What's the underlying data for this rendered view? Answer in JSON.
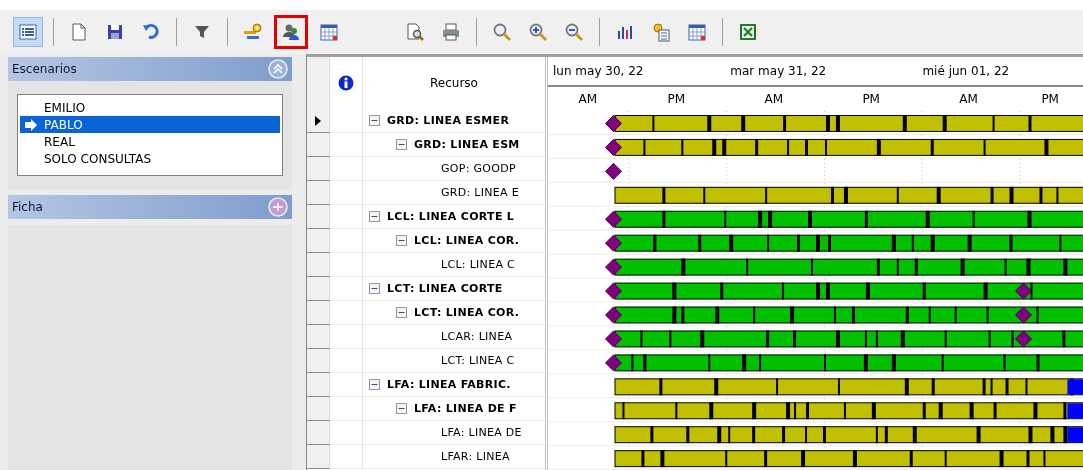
{
  "toolbar": {
    "items": [
      {
        "kind": "list",
        "selected": true,
        "outlined": false
      },
      {
        "kind": "separator"
      },
      {
        "kind": "new",
        "selected": false,
        "outlined": false
      },
      {
        "kind": "save",
        "selected": false,
        "outlined": false
      },
      {
        "kind": "undo",
        "selected": false,
        "outlined": false
      },
      {
        "kind": "separator"
      },
      {
        "kind": "filter",
        "selected": false,
        "outlined": false
      },
      {
        "kind": "separator"
      },
      {
        "kind": "resources",
        "selected": false,
        "outlined": false
      },
      {
        "kind": "users",
        "selected": false,
        "outlined": true
      },
      {
        "kind": "calendar",
        "selected": false,
        "outlined": false
      },
      {
        "kind": "spacer"
      },
      {
        "kind": "preview",
        "selected": false,
        "outlined": false
      },
      {
        "kind": "print",
        "selected": false,
        "outlined": false
      },
      {
        "kind": "separator"
      },
      {
        "kind": "search",
        "selected": false,
        "outlined": false
      },
      {
        "kind": "zoom-in",
        "selected": false,
        "outlined": false
      },
      {
        "kind": "zoom-out",
        "selected": false,
        "outlined": false
      },
      {
        "kind": "separator"
      },
      {
        "kind": "chart",
        "selected": false,
        "outlined": false
      },
      {
        "kind": "tasks",
        "selected": false,
        "outlined": false
      },
      {
        "kind": "calendar",
        "selected": false,
        "outlined": false
      },
      {
        "kind": "separator"
      },
      {
        "kind": "excel",
        "selected": false,
        "outlined": false
      }
    ]
  },
  "sidebar": {
    "panels": [
      {
        "title": "Escenarios",
        "expanded": true,
        "items": [
          {
            "label": "EMILIO",
            "selected": false
          },
          {
            "label": "PABLO",
            "selected": true
          },
          {
            "label": "REAL",
            "selected": false
          },
          {
            "label": "SOLO CONSULTAS",
            "selected": false
          }
        ]
      },
      {
        "title": "Ficha",
        "expanded": false
      }
    ]
  },
  "grid": {
    "column_header": "Recurso",
    "dates": [
      "lun may 30, 22",
      "mar may 31, 22",
      "mié jun 01, 22"
    ],
    "periods": [
      "AM",
      "PM",
      "AM",
      "PM",
      "AM",
      "PM"
    ],
    "rows": [
      {
        "label": "GRD: LINEA ESMER",
        "expanded": true,
        "selected": true,
        "bar": true,
        "milestone": true,
        "mid_milestone": false,
        "color": "#c0c000",
        "children": [
          {
            "label": "GRD: LINEA ESM",
            "expanded": true,
            "selected": false,
            "bar": true,
            "milestone": true,
            "mid_milestone": false,
            "color": "#c0c000",
            "children": [
              {
                "label": "GOP: GOODP",
                "selected": false,
                "bar": false,
                "milestone": true,
                "mid_milestone": false
              },
              {
                "label": "GRD: LINEA E",
                "selected": false,
                "bar": true,
                "milestone": false,
                "mid_milestone": false,
                "color": "#c0c000"
              }
            ]
          }
        ]
      },
      {
        "label": "LCL: LINEA CORTE L",
        "expanded": true,
        "selected": false,
        "bar": true,
        "milestone": true,
        "mid_milestone": false,
        "color": "#00c000",
        "children": [
          {
            "label": "LCL: LINEA COR.",
            "expanded": true,
            "selected": false,
            "bar": true,
            "milestone": true,
            "mid_milestone": false,
            "color": "#00c000",
            "children": [
              {
                "label": "LCL: LINEA C",
                "selected": false,
                "bar": true,
                "milestone": true,
                "mid_milestone": false,
                "color": "#00c000"
              }
            ]
          }
        ]
      },
      {
        "label": "LCT: LINEA CORTE",
        "expanded": true,
        "selected": false,
        "bar": true,
        "milestone": true,
        "mid_milestone": true,
        "color": "#00c000",
        "children": [
          {
            "label": "LCT: LINEA COR.",
            "expanded": true,
            "selected": false,
            "bar": true,
            "milestone": true,
            "mid_milestone": true,
            "color": "#00c000",
            "children": [
              {
                "label": "LCAR: LINEA",
                "selected": false,
                "bar": true,
                "milestone": true,
                "mid_milestone": true,
                "color": "#00c000"
              },
              {
                "label": "LCT: LINEA C",
                "selected": false,
                "bar": true,
                "milestone": true,
                "mid_milestone": false,
                "color": "#00c000"
              }
            ]
          }
        ]
      },
      {
        "label": "LFA: LINEA FABRIC.",
        "expanded": true,
        "selected": false,
        "bar": true,
        "milestone": false,
        "mid_milestone": false,
        "color": "#c0c000",
        "end_segment": {
          "color": "#0000ff"
        },
        "children": [
          {
            "label": "LFA: LINEA DE F",
            "expanded": true,
            "selected": false,
            "bar": true,
            "milestone": false,
            "mid_milestone": false,
            "color": "#c0c000",
            "end_segment": {
              "color": "#0000ff"
            },
            "children": [
              {
                "label": "LFA: LINEA DE",
                "selected": false,
                "bar": true,
                "milestone": false,
                "mid_milestone": false,
                "color": "#c0c000",
                "end_segment": {
                  "color": "#0000ff"
                }
              },
              {
                "label": "LFAR: LINEA",
                "selected": false,
                "bar": true,
                "milestone": false,
                "mid_milestone": false,
                "color": "#c0c000"
              }
            ]
          }
        ]
      }
    ]
  }
}
